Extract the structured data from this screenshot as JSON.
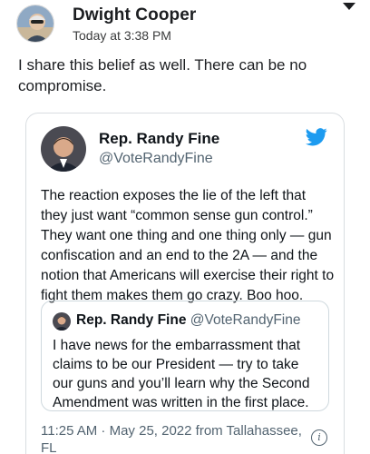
{
  "post": {
    "author": "Dwight Cooper",
    "timestamp": "Today at 3:38 PM",
    "text": "I share this belief as well. There can be no compromise."
  },
  "tweet": {
    "author": "Rep. Randy Fine",
    "handle": "@VoteRandyFine",
    "text": "The reaction exposes the lie of the left that they just want “common sense gun control.” They want one thing and one thing only — gun confiscation and an end to the 2A — and the notion that Americans will exercise their right to fight them makes them go crazy.  Boo hoo.",
    "quote": {
      "author": "Rep. Randy Fine",
      "handle": "@VoteRandyFine",
      "text": "I have news for the embarrassment that claims to be our President — try to take our guns and you’ll learn why the Second Amendment was written in the first place."
    },
    "meta": "11:25 AM · May 25, 2022 from Tallahassee, FL",
    "info_glyph": "i"
  },
  "colors": {
    "twitter_blue": "#1d9bf0",
    "secondary_text": "#536471",
    "card_border": "#d9dde1"
  },
  "icons": {
    "menu": "caret-down-icon",
    "brand": "twitter-bird-icon",
    "info": "info-icon"
  }
}
